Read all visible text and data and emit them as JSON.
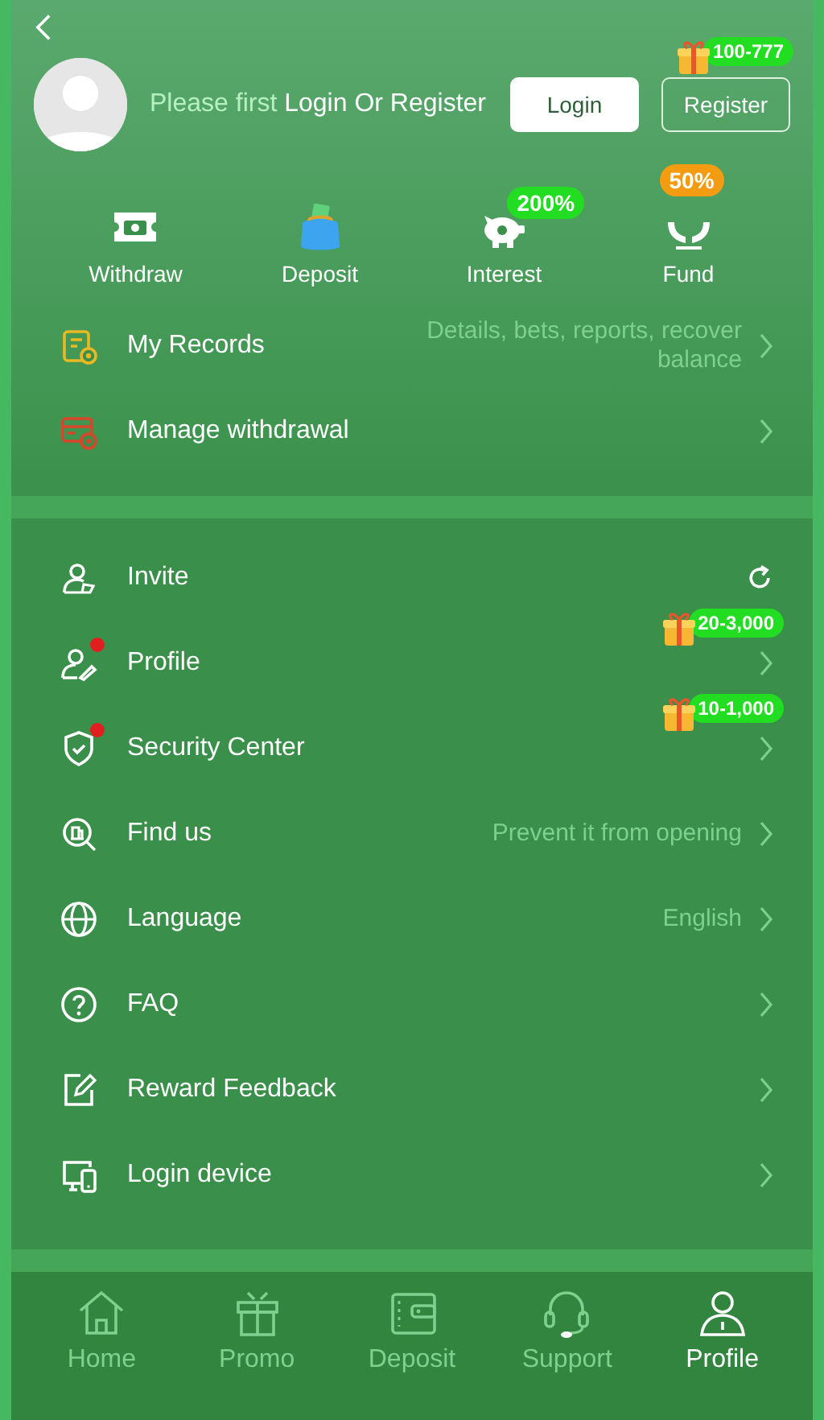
{
  "header": {
    "prompt": "Please first",
    "prompt_action": "Login Or Register",
    "login_button": "Login",
    "register_button": "Register",
    "register_badge": "100-777"
  },
  "quick_actions": [
    {
      "label": "Withdraw"
    },
    {
      "label": "Deposit"
    },
    {
      "label": "Interest",
      "badge": {
        "text": "200%",
        "color": "#22dd22"
      }
    },
    {
      "label": "Fund",
      "badge": {
        "text": "50%",
        "color": "#f39c12"
      }
    }
  ],
  "records": [
    {
      "label": "My Records",
      "hint": "Details, bets, reports, recover balance",
      "kind": "chevron"
    },
    {
      "label": "Manage withdrawal",
      "kind": "chevron"
    }
  ],
  "menu": [
    {
      "label": "Invite",
      "kind": "refresh",
      "notified": false
    },
    {
      "label": "Profile",
      "kind": "chevron",
      "notified": true,
      "badge": "20-3,000"
    },
    {
      "label": "Security Center",
      "kind": "chevron",
      "notified": true,
      "badge": "10-1,000"
    },
    {
      "label": "Find us",
      "kind": "chevron",
      "notified": false,
      "hint": "Prevent it from opening"
    },
    {
      "label": "Language",
      "kind": "chevron",
      "notified": false,
      "hint": "English"
    },
    {
      "label": "FAQ",
      "kind": "chevron",
      "notified": false
    },
    {
      "label": "Reward Feedback",
      "kind": "chevron",
      "notified": false
    },
    {
      "label": "Login device",
      "kind": "chevron",
      "notified": false
    }
  ],
  "bottom_nav": [
    {
      "label": "Home",
      "selected": false
    },
    {
      "label": "Promo",
      "selected": false
    },
    {
      "label": "Deposit",
      "selected": false
    },
    {
      "label": "Support",
      "selected": false
    },
    {
      "label": "Profile",
      "selected": true
    }
  ]
}
